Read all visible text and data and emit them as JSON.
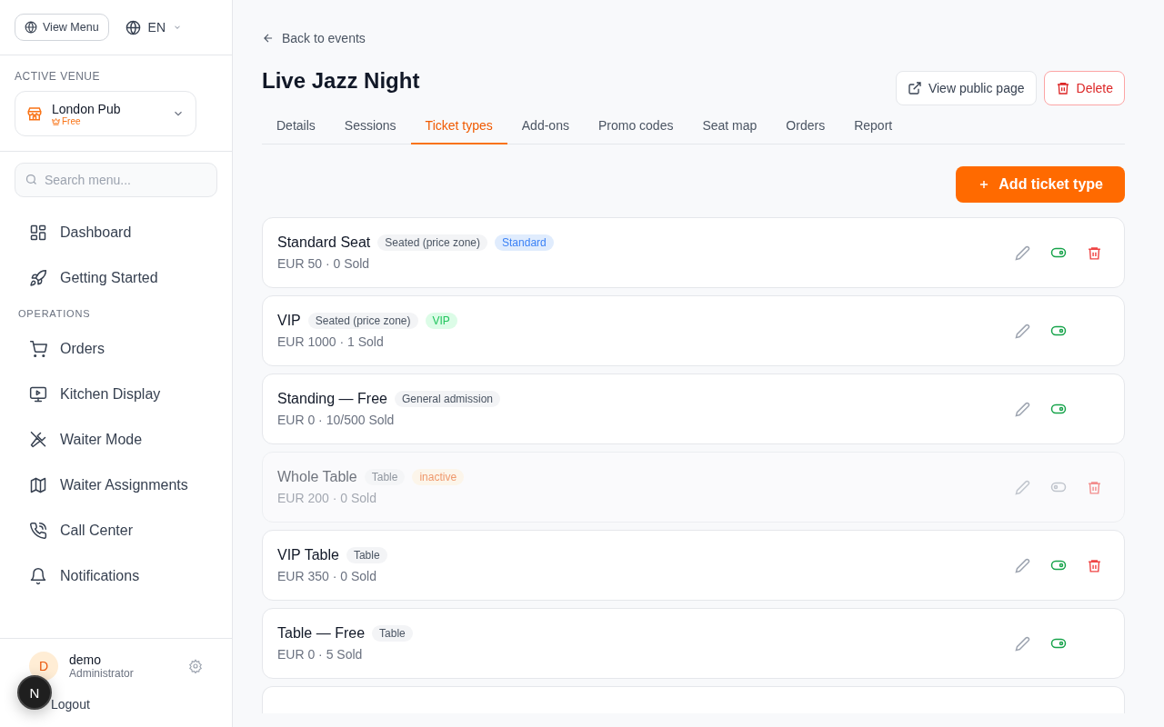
{
  "sidebar": {
    "view_menu": "View Menu",
    "language": "EN",
    "venue_label": "ACTIVE VENUE",
    "venue": {
      "name": "London Pub",
      "plan": "Free"
    },
    "search": {
      "placeholder": "Search menu..."
    },
    "items": [
      {
        "label": "Dashboard"
      },
      {
        "label": "Getting Started"
      },
      {
        "label": "Orders",
        "section": "OPERATIONS"
      },
      {
        "label": "Kitchen Display"
      },
      {
        "label": "Waiter Mode"
      },
      {
        "label": "Waiter Assignments"
      },
      {
        "label": "Call Center"
      },
      {
        "label": "Notifications"
      }
    ],
    "user": {
      "initial": "D",
      "name": "demo",
      "role": "Administrator"
    },
    "logout": "Logout",
    "dev_badge": "N"
  },
  "main": {
    "back": "Back to events",
    "title": "Live Jazz Night",
    "view_public": "View public page",
    "delete": "Delete",
    "tabs": [
      {
        "label": "Details",
        "selected": false
      },
      {
        "label": "Sessions",
        "selected": false
      },
      {
        "label": "Ticket types",
        "selected": true
      },
      {
        "label": "Add-ons",
        "selected": false
      },
      {
        "label": "Promo codes",
        "selected": false
      },
      {
        "label": "Seat map",
        "selected": false
      },
      {
        "label": "Orders",
        "selected": false
      },
      {
        "label": "Report",
        "selected": false
      }
    ],
    "add_button": "Add ticket type",
    "ticket_types": [
      {
        "name": "Standard Seat",
        "tags": [
          {
            "text": "Seated (price zone)",
            "kind": "type"
          },
          {
            "text": "Standard",
            "kind": "zone"
          }
        ],
        "detail": "EUR 50 · 0 Sold",
        "active": true,
        "deletable": true
      },
      {
        "name": "VIP",
        "tags": [
          {
            "text": "Seated (price zone)",
            "kind": "type"
          },
          {
            "text": "VIP",
            "kind": "vip"
          }
        ],
        "detail": "EUR 1000 · 1 Sold",
        "active": true,
        "deletable": false
      },
      {
        "name": "Standing — Free",
        "tags": [
          {
            "text": "General admission",
            "kind": "type"
          }
        ],
        "detail": "EUR 0 · 10/500 Sold",
        "active": true,
        "deletable": false
      },
      {
        "name": "Whole Table",
        "tags": [
          {
            "text": "Table",
            "kind": "type"
          },
          {
            "text": "inactive",
            "kind": "status"
          }
        ],
        "detail": "EUR 200 · 0 Sold",
        "active": false,
        "deletable": true
      },
      {
        "name": "VIP Table",
        "tags": [
          {
            "text": "Table",
            "kind": "type"
          }
        ],
        "detail": "EUR 350 · 0 Sold",
        "active": true,
        "deletable": true
      },
      {
        "name": "Table — Free",
        "tags": [
          {
            "text": "Table",
            "kind": "type"
          }
        ],
        "detail": "EUR 0 · 5 Sold",
        "active": true,
        "deletable": false
      }
    ]
  }
}
